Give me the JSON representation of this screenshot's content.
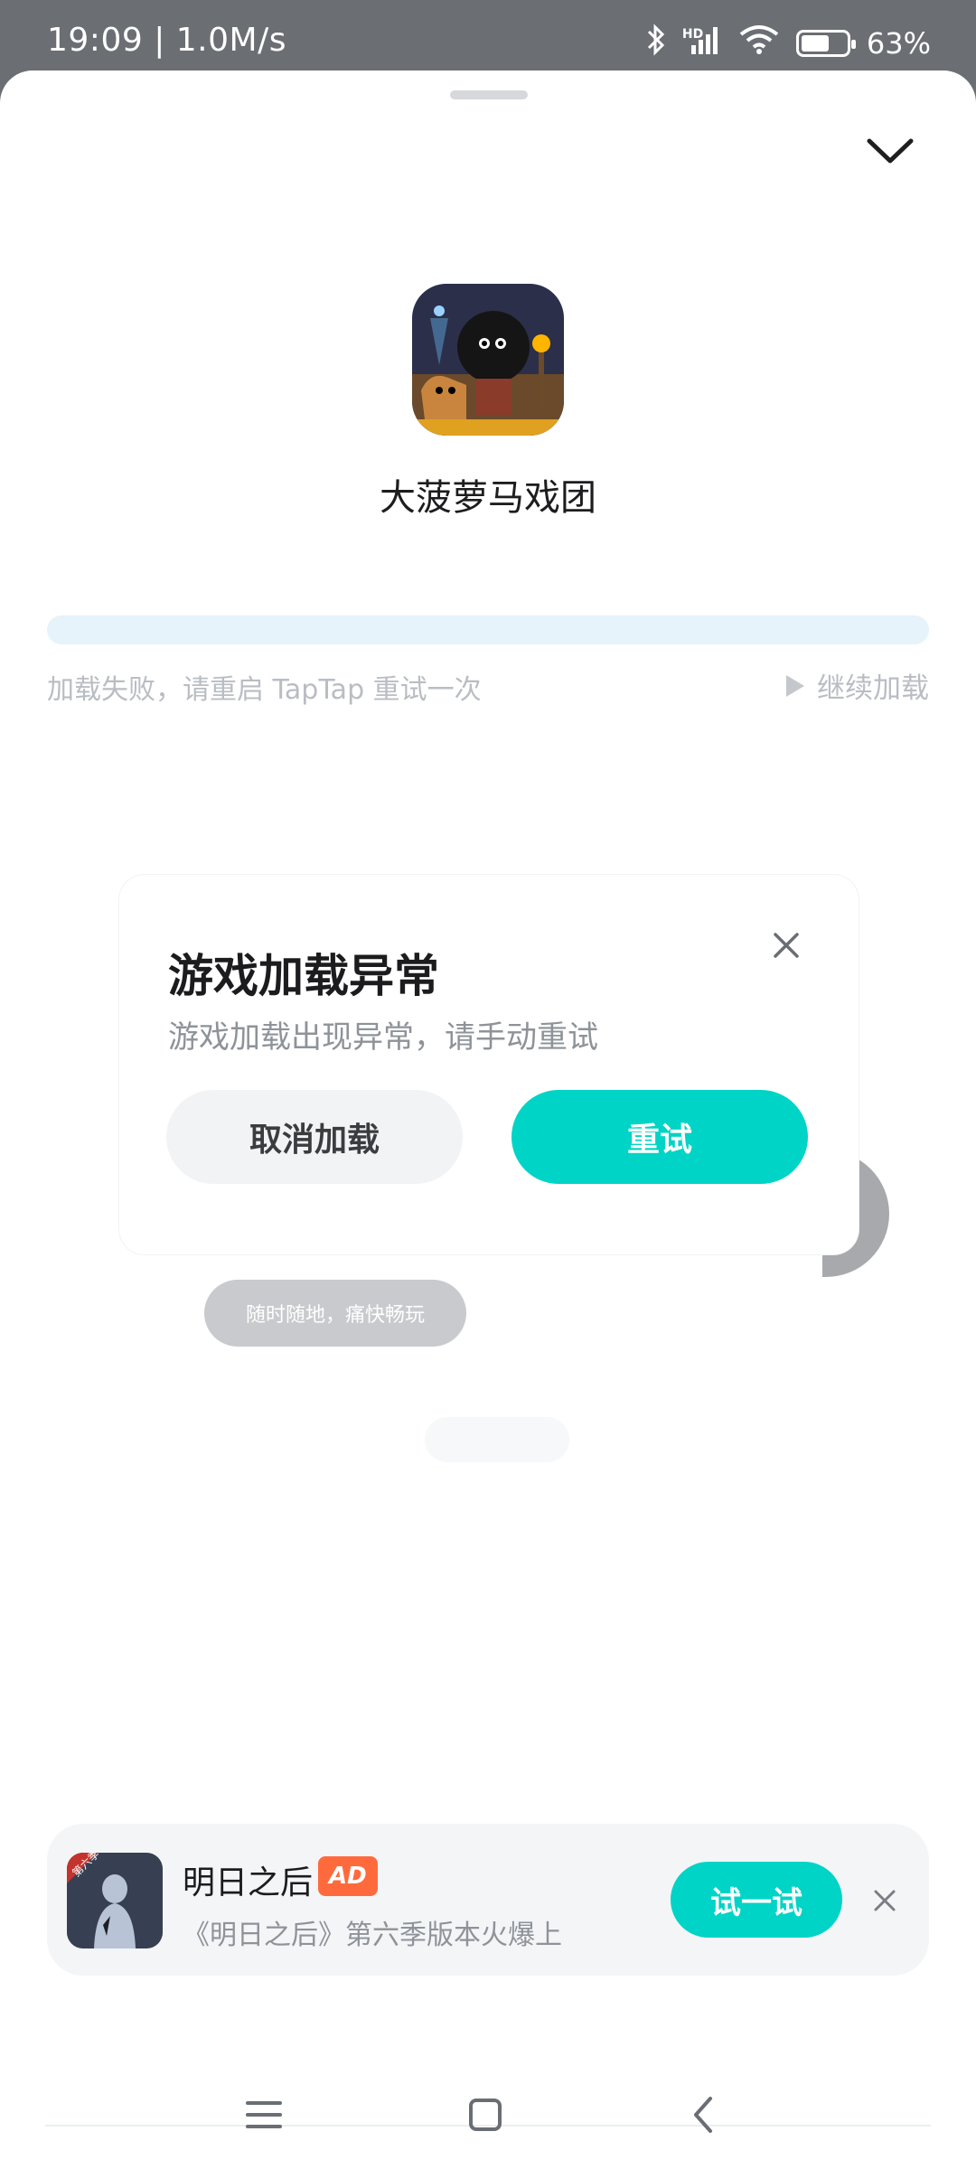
{
  "status_bar": {
    "time_speed": "19:09 | 1.0M/s",
    "icons": [
      "bluetooth-icon",
      "hd-signal-icon",
      "wifi-icon",
      "battery-icon"
    ],
    "signal_label": "HD",
    "battery_level": 63,
    "battery_text": "63%"
  },
  "sheet": {
    "collapse_icon": "chevron-down-icon"
  },
  "game": {
    "name": "大菠萝马戏团"
  },
  "loading": {
    "progress": 0.0,
    "error_text": "加载失败，请重启 TapTap 重试一次",
    "continue_label": "继续加载"
  },
  "background": {
    "pill_text": "随时随地，痛快畅玩"
  },
  "dialog": {
    "title": "游戏加载异常",
    "message": "游戏加载出现异常，请手动重试",
    "cancel_label": "取消加载",
    "retry_label": "重试"
  },
  "ad": {
    "title": "明日之后",
    "badge": "AD",
    "description": "《明日之后》第六季版本火爆上",
    "cta_label": "试一试",
    "icon_badge": "第六季"
  },
  "nav": {
    "icons": [
      "menu-icon",
      "home-icon",
      "back-icon"
    ]
  },
  "colors": {
    "accent": "#00d4c6",
    "ad_badge": "#ff6a3d"
  }
}
